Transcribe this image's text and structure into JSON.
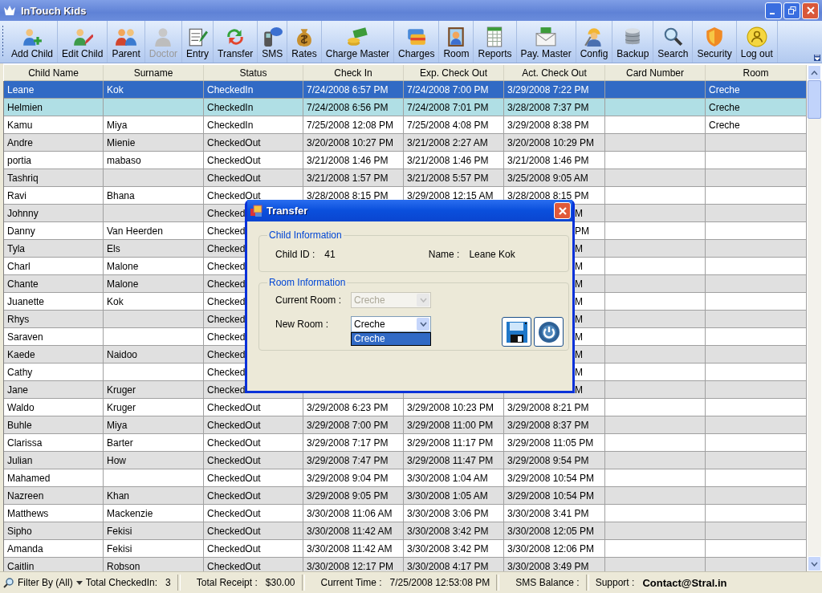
{
  "window": {
    "title": "InTouch Kids"
  },
  "toolbar": [
    {
      "label": "Add Child",
      "disabled": false
    },
    {
      "label": "Edit Child",
      "disabled": false
    },
    {
      "label": "Parent",
      "disabled": false
    },
    {
      "label": "Doctor",
      "disabled": true
    },
    {
      "label": "Entry",
      "disabled": false
    },
    {
      "label": "Transfer",
      "disabled": false
    },
    {
      "label": "SMS",
      "disabled": false
    },
    {
      "label": "Rates",
      "disabled": false
    },
    {
      "label": "Charge Master",
      "disabled": false
    },
    {
      "label": "Charges",
      "disabled": false
    },
    {
      "label": "Room",
      "disabled": false
    },
    {
      "label": "Reports",
      "disabled": false
    },
    {
      "label": "Pay. Master",
      "disabled": false
    },
    {
      "label": "Config",
      "disabled": false
    },
    {
      "label": "Backup",
      "disabled": false
    },
    {
      "label": "Search",
      "disabled": false
    },
    {
      "label": "Security",
      "disabled": false
    },
    {
      "label": "Log out",
      "disabled": false
    }
  ],
  "table": {
    "columns": [
      "Child Name",
      "Surname",
      "Status",
      "Check In",
      "Exp. Check Out",
      "Act. Check Out",
      "Card Number",
      "Room"
    ],
    "rows": [
      {
        "child_name": "Leane",
        "surname": "Kok",
        "status": "CheckedIn",
        "check_in": "7/24/2008 6:57 PM",
        "exp_check_out": "7/24/2008 7:00 PM",
        "act_check_out": "3/29/2008 7:22 PM",
        "room": "Creche",
        "selected": true,
        "marked": false,
        "covered": false
      },
      {
        "child_name": "Helmien",
        "status": "CheckedIn",
        "check_in": "7/24/2008 6:56 PM",
        "exp_check_out": "7/24/2008 7:01 PM",
        "act_check_out": "3/28/2008 7:37 PM",
        "room": "Creche",
        "selected": false,
        "marked": true,
        "covered": false
      },
      {
        "child_name": "Kamu",
        "surname": "Miya",
        "status": "CheckedIn",
        "check_in": "7/25/2008 12:08 PM",
        "exp_check_out": "7/25/2008 4:08 PM",
        "act_check_out": "3/29/2008 8:38 PM",
        "room": "Creche",
        "selected": false,
        "marked": false,
        "covered": false
      },
      {
        "child_name": "Andre",
        "surname": "Mienie",
        "status": "CheckedOut",
        "check_in": "3/20/2008 10:27 PM",
        "exp_check_out": "3/21/2008 2:27 AM",
        "act_check_out": "3/20/2008 10:29 PM",
        "selected": false,
        "marked": false,
        "covered": false
      },
      {
        "child_name": "portia",
        "surname": "mabaso",
        "status": "CheckedOut",
        "check_in": "3/21/2008 1:46 PM",
        "exp_check_out": "3/21/2008 1:46 PM",
        "act_check_out": "3/21/2008 1:46 PM",
        "selected": false,
        "marked": false,
        "covered": false
      },
      {
        "child_name": "Tashriq",
        "status": "CheckedOut",
        "check_in": "3/21/2008 1:57 PM",
        "exp_check_out": "3/21/2008 5:57 PM",
        "act_check_out": "3/25/2008 9:05 AM",
        "selected": false,
        "marked": false,
        "covered": false
      },
      {
        "child_name": "Ravi",
        "surname": "Bhana",
        "status": "CheckedOut",
        "check_in": "3/28/2008 8:15 PM",
        "exp_check_out": "3/29/2008 12:15 AM",
        "act_check_out": "3/28/2008 8:15 PM",
        "selected": false,
        "marked": false,
        "covered": false
      },
      {
        "child_name": "Johnny",
        "status": "Checked",
        "act_check_out": "M",
        "selected": false,
        "marked": false,
        "covered": true
      },
      {
        "child_name": "Danny",
        "surname": "Van Heerden",
        "status": "Checked",
        "act_check_out": "PM",
        "selected": false,
        "marked": false,
        "covered": true
      },
      {
        "child_name": "Tyla",
        "surname": "Els",
        "status": "Checked",
        "act_check_out": "M",
        "selected": false,
        "marked": false,
        "covered": true
      },
      {
        "child_name": "Charl",
        "surname": "Malone",
        "status": "Checked",
        "act_check_out": "M",
        "selected": false,
        "marked": false,
        "covered": true
      },
      {
        "child_name": "Chante",
        "surname": "Malone",
        "status": "Checked",
        "act_check_out": "M",
        "selected": false,
        "marked": false,
        "covered": true
      },
      {
        "child_name": "Juanette",
        "surname": "Kok",
        "status": "Checked",
        "act_check_out": "M",
        "selected": false,
        "marked": false,
        "covered": true
      },
      {
        "child_name": "Rhys",
        "status": "Checked",
        "act_check_out": "M",
        "selected": false,
        "marked": false,
        "covered": true
      },
      {
        "child_name": "Saraven",
        "status": "Checked",
        "act_check_out": "M",
        "selected": false,
        "marked": false,
        "covered": true
      },
      {
        "child_name": "Kaede",
        "surname": "Naidoo",
        "status": "Checked",
        "act_check_out": "M",
        "selected": false,
        "marked": false,
        "covered": true
      },
      {
        "child_name": "Cathy",
        "status": "Checked",
        "act_check_out": "M",
        "selected": false,
        "marked": false,
        "covered": true
      },
      {
        "child_name": "Jane",
        "surname": "Kruger",
        "status": "Checked",
        "act_check_out": "M",
        "selected": false,
        "marked": false,
        "covered": true
      },
      {
        "child_name": "Waldo",
        "surname": "Kruger",
        "status": "CheckedOut",
        "check_in": "3/29/2008 6:23 PM",
        "exp_check_out": "3/29/2008 10:23 PM",
        "act_check_out": "3/29/2008 8:21 PM",
        "selected": false,
        "marked": false,
        "covered": false
      },
      {
        "child_name": "Buhle",
        "surname": "Miya",
        "status": "CheckedOut",
        "check_in": "3/29/2008 7:00 PM",
        "exp_check_out": "3/29/2008 11:00 PM",
        "act_check_out": "3/29/2008 8:37 PM",
        "selected": false,
        "marked": false,
        "covered": false
      },
      {
        "child_name": "Clarissa",
        "surname": "Barter",
        "status": "CheckedOut",
        "check_in": "3/29/2008 7:17 PM",
        "exp_check_out": "3/29/2008 11:17 PM",
        "act_check_out": "3/29/2008 11:05 PM",
        "selected": false,
        "marked": false,
        "covered": false
      },
      {
        "child_name": "Julian",
        "surname": "How",
        "status": "CheckedOut",
        "check_in": "3/29/2008 7:47 PM",
        "exp_check_out": "3/29/2008 11:47 PM",
        "act_check_out": "3/29/2008 9:54 PM",
        "selected": false,
        "marked": false,
        "covered": false
      },
      {
        "child_name": "Mahamed",
        "status": "CheckedOut",
        "check_in": "3/29/2008 9:04 PM",
        "exp_check_out": "3/30/2008 1:04 AM",
        "act_check_out": "3/29/2008 10:54 PM",
        "selected": false,
        "marked": false,
        "covered": false
      },
      {
        "child_name": "Nazreen",
        "surname": "Khan",
        "status": "CheckedOut",
        "check_in": "3/29/2008 9:05 PM",
        "exp_check_out": "3/30/2008 1:05 AM",
        "act_check_out": "3/29/2008 10:54 PM",
        "selected": false,
        "marked": false,
        "covered": false
      },
      {
        "child_name": "Matthews",
        "surname": "Mackenzie",
        "status": "CheckedOut",
        "check_in": "3/30/2008 11:06 AM",
        "exp_check_out": "3/30/2008 3:06 PM",
        "act_check_out": "3/30/2008 3:41 PM",
        "selected": false,
        "marked": false,
        "covered": false
      },
      {
        "child_name": "Sipho",
        "surname": "Fekisi",
        "status": "CheckedOut",
        "check_in": "3/30/2008 11:42 AM",
        "exp_check_out": "3/30/2008 3:42 PM",
        "act_check_out": "3/30/2008 12:05 PM",
        "selected": false,
        "marked": false,
        "covered": false
      },
      {
        "child_name": "Amanda",
        "surname": "Fekisi",
        "status": "CheckedOut",
        "check_in": "3/30/2008 11:42 AM",
        "exp_check_out": "3/30/2008 3:42 PM",
        "act_check_out": "3/30/2008 12:06 PM",
        "selected": false,
        "marked": false,
        "covered": false
      },
      {
        "child_name": "Caitlin",
        "surname": "Robson",
        "status": "CheckedOut",
        "check_in": "3/30/2008 12:17 PM",
        "exp_check_out": "3/30/2008 4:17 PM",
        "act_check_out": "3/30/2008 3:49 PM",
        "selected": false,
        "marked": false,
        "covered": false
      }
    ]
  },
  "dialog": {
    "title": "Transfer",
    "child_group": {
      "legend": "Child Information",
      "id_label": "Child ID :",
      "id_value": "41",
      "name_label": "Name :",
      "name_value": "Leane Kok"
    },
    "room_group": {
      "legend": "Room Information",
      "current_label": "Current Room :",
      "current_value": "Creche",
      "current_disabled": true,
      "new_label": "New Room :",
      "new_value": "Creche",
      "dropdown": [
        {
          "label": "Creche",
          "selected": true
        }
      ]
    }
  },
  "status_bar": {
    "filter": "Filter By (All)",
    "checked_in_label": "Total CheckedIn:",
    "checked_in_value": "3",
    "receipt_label": "Total Receipt :",
    "receipt_value": "$30.00",
    "time_label": "Current Time :",
    "time_value": "7/25/2008 12:53:08 PM",
    "sms_label": "SMS Balance :",
    "support_label": "Support :",
    "support_value": "Contact@Stral.in"
  }
}
